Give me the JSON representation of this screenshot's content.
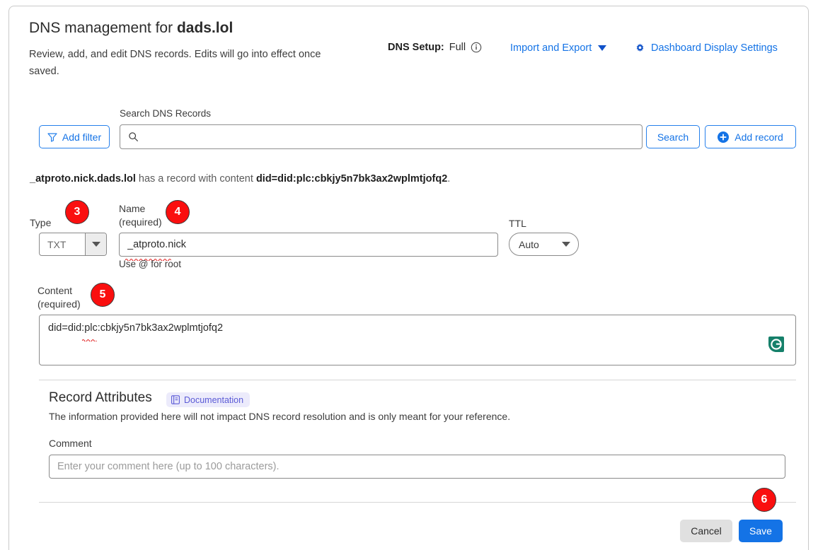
{
  "header": {
    "title_prefix": "DNS management for ",
    "domain": "dads.lol",
    "subtitle": "Review, add, and edit DNS records. Edits will go into effect once saved.",
    "dns_setup_label": "DNS Setup:",
    "dns_setup_value": "Full",
    "info_icon": "info-circle-icon",
    "import_export_label": "Import and Export",
    "import_export_caret": "chevron-down-icon",
    "dashboard_settings_label": "Dashboard Display Settings",
    "dashboard_settings_icon": "gear-icon"
  },
  "toolbar": {
    "add_filter_label": "Add filter",
    "add_filter_icon": "filter-funnel-icon",
    "search_label": "Search DNS Records",
    "search_icon": "search-icon",
    "search_value": "",
    "search_placeholder": "",
    "search_button_label": "Search",
    "add_record_label": "Add record",
    "add_record_icon": "plus-circle-icon"
  },
  "summary": {
    "record_name": "_atproto.nick.dads.lol",
    "middle": " has a record with content ",
    "record_content": "did=did:plc:cbkjy5n7bk3ax2wplmtjofq2",
    "period": "."
  },
  "form": {
    "type_label": "Type",
    "type_value": "TXT",
    "type_caret": "chevron-down-icon",
    "name_label_line1": "Name",
    "name_label_line2": "(required)",
    "name_value": "_atproto.nick",
    "name_hint": "Use @ for root",
    "ttl_label": "TTL",
    "ttl_value": "Auto",
    "ttl_caret": "chevron-down-icon",
    "content_label_line1": "Content",
    "content_label_line2": "(required)",
    "content_value": "did=did:plc:cbkjy5n7bk3ax2wplmtjofq2",
    "grammarly_icon": "grammarly-icon"
  },
  "record_attributes": {
    "title": "Record Attributes",
    "doc_badge_label": "Documentation",
    "doc_badge_icon": "document-icon",
    "description": "The information provided here will not impact DNS record resolution and is only meant for your reference.",
    "comment_label": "Comment",
    "comment_value": "",
    "comment_placeholder": "Enter your comment here (up to 100 characters)."
  },
  "footer": {
    "cancel_label": "Cancel",
    "save_label": "Save"
  },
  "annotations": {
    "badge3": "3",
    "badge4": "4",
    "badge5": "5",
    "badge6": "6"
  },
  "colors": {
    "link_blue": "#1473e6",
    "save_blue": "#1473e6",
    "badge_red": "#fa0f0f",
    "badge_purple": "#5b5bd6",
    "grammarly_green": "#15806a"
  }
}
